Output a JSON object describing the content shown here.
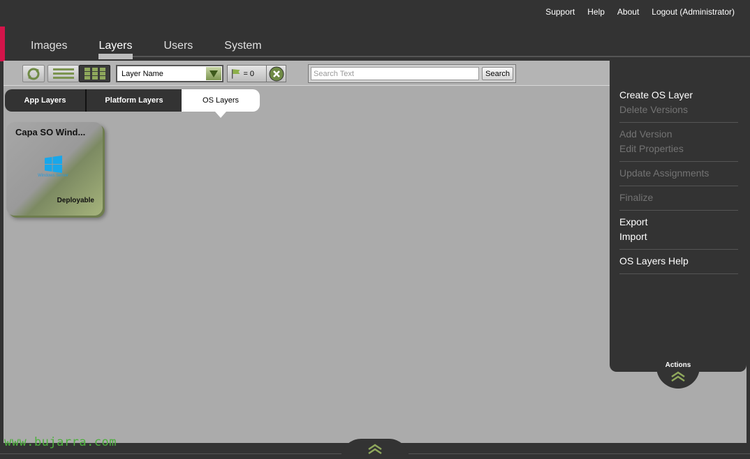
{
  "top_links": [
    "Support",
    "Help",
    "About",
    "Logout (Administrator)"
  ],
  "main_tabs": [
    "Images",
    "Layers",
    "Users",
    "System"
  ],
  "active_main_tab": "Layers",
  "toolbar": {
    "sort_select_value": "Layer Name",
    "flag_count": "= 0",
    "search_placeholder": "Search Text",
    "search_label": "Search"
  },
  "sub_tabs": [
    "App Layers",
    "Platform Layers",
    "OS Layers"
  ],
  "active_sub_tab": "OS Layers",
  "layer_card": {
    "title": "Capa SO Wind...",
    "logo_caption": "Windows Server",
    "status": "Deployable"
  },
  "actions": {
    "groups": [
      [
        {
          "label": "Create OS Layer",
          "enabled": true
        },
        {
          "label": "Delete Versions",
          "enabled": false
        }
      ],
      [
        {
          "label": "Add Version",
          "enabled": false
        },
        {
          "label": "Edit Properties",
          "enabled": false
        }
      ],
      [
        {
          "label": "Update Assignments",
          "enabled": false
        }
      ],
      [
        {
          "label": "Finalize",
          "enabled": false
        }
      ],
      [
        {
          "label": "Export",
          "enabled": true
        },
        {
          "label": "Import",
          "enabled": true
        }
      ],
      [
        {
          "label": "OS Layers Help",
          "enabled": true
        }
      ]
    ],
    "toggle_label": "Actions"
  },
  "watermark": "www.bujarra.com",
  "colors": {
    "accent": "#d4144a",
    "chrome": "#333333",
    "content_bg": "#ababab",
    "enabled_green": "#7c9450"
  }
}
